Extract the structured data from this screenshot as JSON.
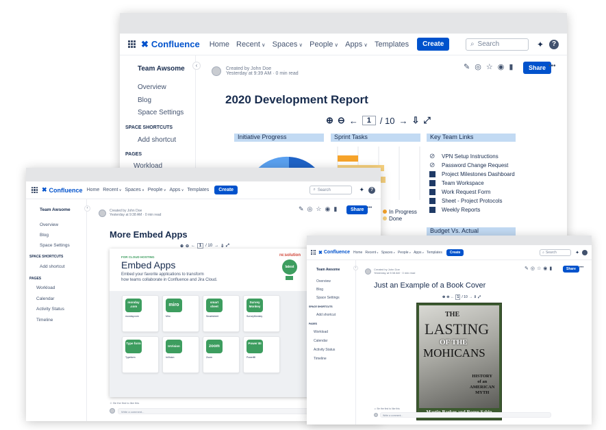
{
  "brand": "Confluence",
  "nav": {
    "home": "Home",
    "recent": "Recent",
    "spaces": "Spaces",
    "people": "People",
    "apps": "Apps",
    "templates": "Templates",
    "create": "Create"
  },
  "search_placeholder": "Search",
  "sidebar": {
    "space": "Team Awsome",
    "overview": "Overview",
    "blog": "Blog",
    "settings": "Space Settings",
    "shortcuts_header": "SPACE SHORTCUTS",
    "add_shortcut": "Add shortcut",
    "pages_header": "PAGES",
    "workload": "Workload",
    "calendar": "Calendar",
    "activity": "Activity Status",
    "timeline": "Timeline"
  },
  "meta": {
    "created_by": "Created by John Doe",
    "when": "Yesterday at 9:39 AM",
    "read": "0 min read",
    "when_b": "Yesterday at 9:38 AM",
    "share": "Share"
  },
  "win_back": {
    "title": "2020 Development Report",
    "viewer": {
      "page": "1",
      "total": "/ 10"
    },
    "panels": {
      "initiative": "Initiative Progress",
      "sprint": "Sprint Tasks",
      "links": "Key Team Links",
      "budget": "Budget Vs. Actual"
    },
    "legend": {
      "in_progress": "In Progress",
      "done": "Done"
    },
    "links": [
      {
        "label": "VPN Setup Instructions",
        "icon": "link-icon"
      },
      {
        "label": "Password Change Request",
        "icon": "link-icon"
      },
      {
        "label": "Project Milestones Dashboard",
        "icon": "page-icon"
      },
      {
        "label": "Team Workspace",
        "icon": "page-icon"
      },
      {
        "label": "Work Request Form",
        "icon": "page-icon"
      },
      {
        "label": "Sheet - Project Protocols",
        "icon": "page-icon"
      },
      {
        "label": "Weekly Reports",
        "icon": "page-icon"
      }
    ]
  },
  "win_mid": {
    "title": "More Embed Apps",
    "viewer": {
      "page": "1",
      "total": "/ 10"
    },
    "banner": {
      "kicker": "FOR CLOUD HOSTING",
      "heading": "Embed Apps",
      "body1": "Embed your favorite applications to transform",
      "body2": "how teams collaborate in Confluence and Jira Cloud.",
      "vendor": "re:solution",
      "badge": "latest"
    },
    "apps": [
      {
        "logo": "monday .com",
        "name": "monday.com",
        "color": "#3d9d5f"
      },
      {
        "logo": "miro",
        "name": "Miro",
        "color": "#2b2b2b"
      },
      {
        "logo": "smart sheet",
        "name": "Smartsheet",
        "color": "#3d9d5f"
      },
      {
        "logo": "Survey Monkey",
        "name": "SurveyMonkey",
        "color": "#3d9d5f"
      },
      {
        "logo": "Type form",
        "name": "Typeform",
        "color": "#3d9d5f"
      },
      {
        "logo": "InVision",
        "name": "InVision",
        "color": "#3d9d5f"
      },
      {
        "logo": "zoom",
        "name": "Zoom",
        "color": "#3d9d5f"
      },
      {
        "logo": "Power BI",
        "name": "PowerBI",
        "color": "#3d9d5f"
      }
    ],
    "likes": "Be the first to like this",
    "comment": "Write a comment..."
  },
  "win_front": {
    "title": "Just an Example of a Book Cover",
    "viewer": {
      "page": "1",
      "total": "/ 10"
    },
    "book": {
      "line1": "THE",
      "line2": "LASTING",
      "line3": "OF THE",
      "line4": "MOHICANS",
      "sub1": "HISTORY",
      "sub2": "of an",
      "sub3": "AMERICAN",
      "sub4": "MYTH",
      "authors": "Martin Barker and Roger Sabin"
    },
    "likes": "Be the first to like this",
    "comment": "Write a comment..."
  },
  "colors": {
    "accent": "#0052cc",
    "panel": "#c2daf3",
    "sprint_orange": "#f6a32a",
    "done": "#f7d17e",
    "chart_blue": "#1f63c7"
  }
}
